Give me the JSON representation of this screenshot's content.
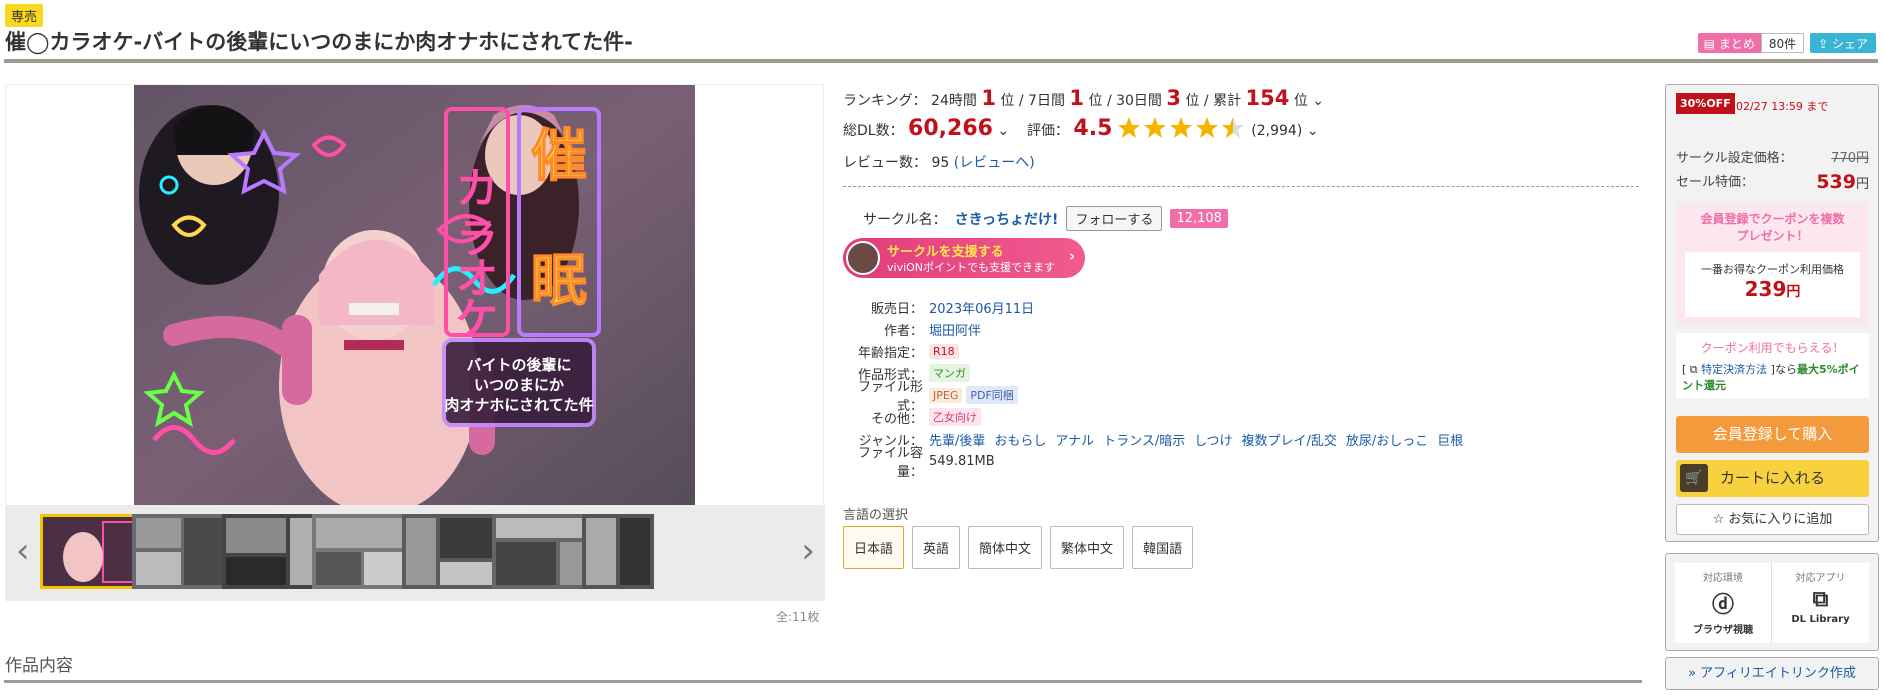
{
  "header": {
    "badge": "専売",
    "title": "催◯カラオケ-バイトの後輩にいつのまにか肉オナホにされてた件-",
    "matome_label": "まとめ",
    "matome_count": "80件",
    "share_label": "シェア"
  },
  "gallery": {
    "cover_title_big": "催眠",
    "cover_title_kana": "カラオケ",
    "cover_subtitle": "バイトの後輩に いつのまにか 肉オナホにされてた件",
    "thumb_count": "全:11枚"
  },
  "ranking": {
    "label": "ランキング：",
    "h24_label": "24時間",
    "h24_value": "1",
    "d7_label": "7日間",
    "d7_value": "1",
    "d30_label": "30日間",
    "d30_value": "3",
    "total_label": "累計",
    "total_value": "154",
    "unit": "位",
    "sep": "/"
  },
  "stats": {
    "dl_label": "総DL数：",
    "dl_value": "60,266",
    "rating_label": "評価：",
    "rating_value": "4.5",
    "rating_count": "(2,994)",
    "review_label": "レビュー数：",
    "review_value": "95",
    "review_link": "(レビューへ)"
  },
  "circle": {
    "label": "サークル名：",
    "name": "さきっちょだけ!",
    "follow_label": "フォローする",
    "follow_count": "12,108",
    "support_title": "サークルを支援する",
    "support_sub": "viviONポイントでも支援できます"
  },
  "spec": {
    "release_label": "販売日：",
    "release_value": "2023年06月11日",
    "author_label": "作者：",
    "author_value": "堀田阿伴",
    "age_label": "年齢指定：",
    "age_value": "R18",
    "format_label": "作品形式：",
    "format_value": "マンガ",
    "file_label": "ファイル形式：",
    "file_value1": "JPEG",
    "file_value2": "PDF同梱",
    "other_label": "その他：",
    "other_value": "乙女向け",
    "genre_label": "ジャンル：",
    "genres": [
      "先輩/後輩",
      "おもらし",
      "アナル",
      "トランス/暗示",
      "しつけ",
      "複数プレイ/乱交",
      "放尿/おしっこ",
      "巨根"
    ],
    "size_label": "ファイル容量：",
    "size_value": "549.81MB"
  },
  "language": {
    "title": "言語の選択",
    "options": [
      "日本語",
      "英語",
      "簡体中文",
      "繁体中文",
      "韓国語"
    ]
  },
  "section": {
    "title": "作品内容"
  },
  "buy": {
    "off_badge": "30%OFF",
    "off_until": "02/27 13:59 まで",
    "list_label": "サークル設定価格：",
    "list_price": "770円",
    "sale_label": "セール特価：",
    "sale_price": "539",
    "sale_unit": "円",
    "coupon_head_1": "会員登録でクーポンを複数",
    "coupon_head_2": "プレゼント！",
    "coupon_inner_label": "一番お得なクーポン利用価格",
    "coupon_price": "239",
    "coupon_unit": "円",
    "coupon2_head": "クーポン利用でもらえる！",
    "coupon2_text_a": "[ ",
    "coupon2_link": "特定決済方法",
    "coupon2_text_b": " ]なら",
    "coupon2_green": "最大5%ポイント還元",
    "register_label": "会員登録して購入",
    "cart_label": "カートに入れる",
    "fav_label": "お気に入りに追加"
  },
  "env": {
    "env_head": "対応環境",
    "env_name": "ブラウザ視聴",
    "app_head": "対応アプリ",
    "app_name": "DL Library"
  },
  "affiliate": {
    "label": "» アフィリエイトリンク作成"
  },
  "colors": {
    "accent_red": "#c0111a",
    "pink": "#f06ea9",
    "orange": "#f29a3c",
    "yellow": "#f7d23e",
    "rule": "#a29a91"
  }
}
